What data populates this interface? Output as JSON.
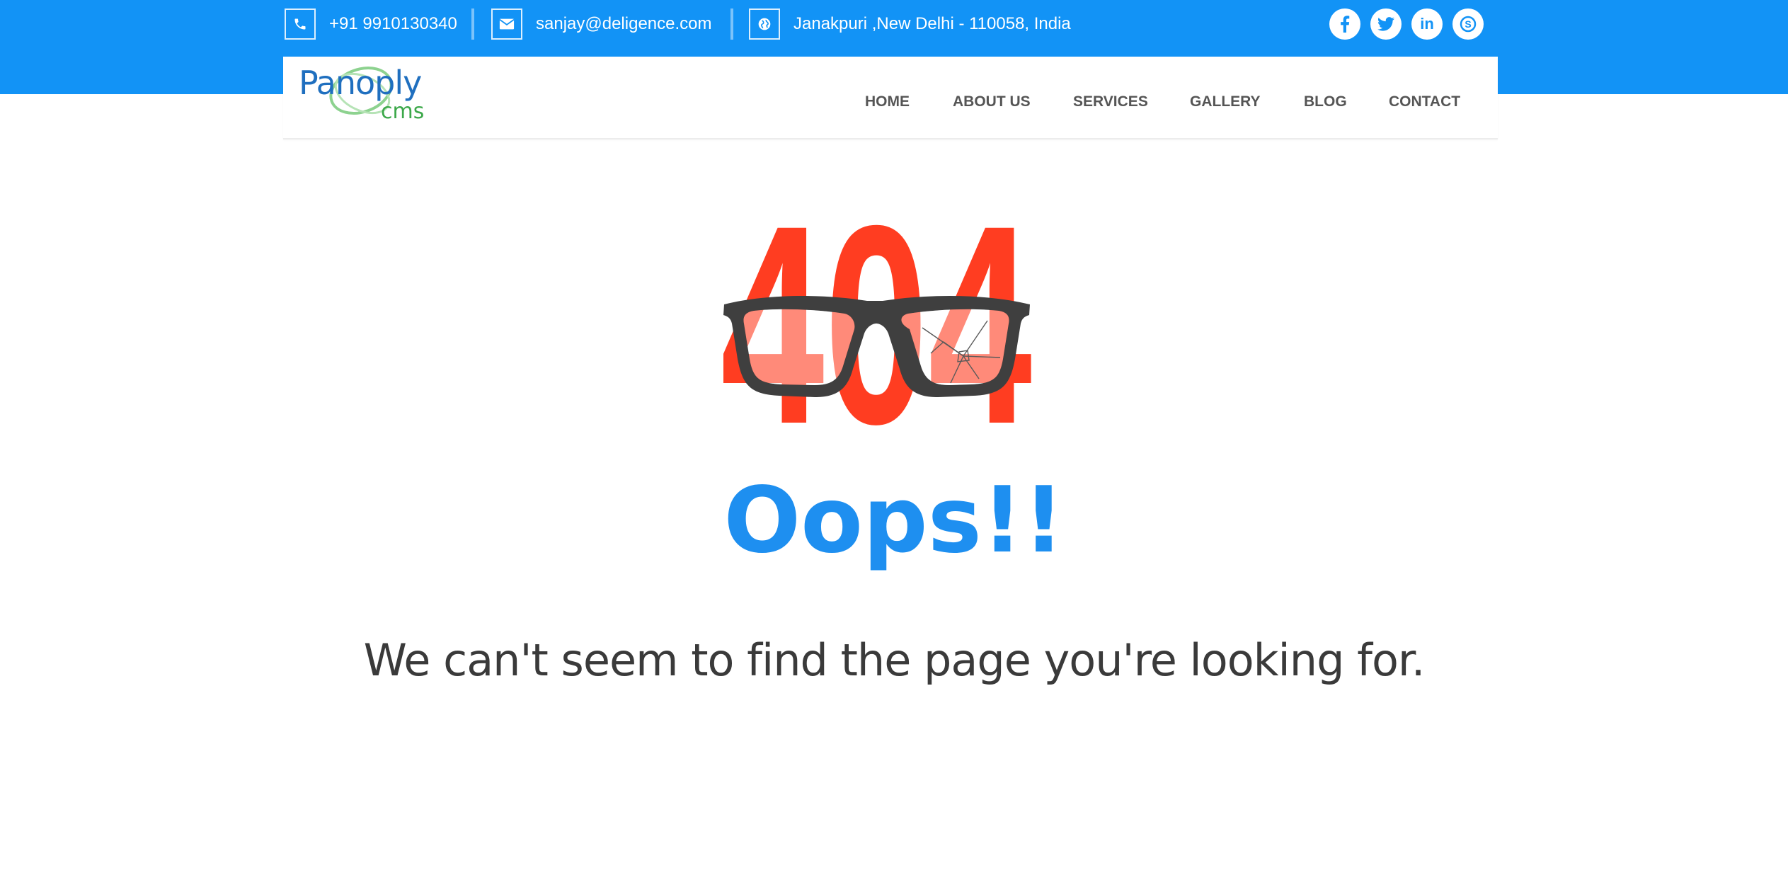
{
  "topbar": {
    "phone": "+91 9910130340",
    "email": "sanjay@deligence.com",
    "address": "Janakpuri ,New Delhi - 110058, India",
    "icons": {
      "phone": "phone-icon",
      "email": "envelope-icon",
      "address": "globe-icon"
    },
    "social": [
      {
        "name": "facebook-icon",
        "glyph": "f"
      },
      {
        "name": "twitter-icon",
        "glyph": ""
      },
      {
        "name": "linkedin-icon",
        "glyph": "in"
      },
      {
        "name": "skype-icon",
        "glyph": "S"
      }
    ]
  },
  "logo": {
    "word": "Panoply",
    "sub": "cms"
  },
  "nav": {
    "home": "HOME",
    "about": "ABOUT US",
    "services": "SERVICES",
    "gallery": "GALLERY",
    "blog": "BLOG",
    "contact": "CONTACT"
  },
  "error": {
    "code": "404",
    "title": "Oops!!",
    "message": "We can't seem to find the page you're looking for."
  },
  "colors": {
    "brand_blue": "#1293f6",
    "error_red": "#ff3d21",
    "oops_blue": "#1e8ff0",
    "text_dark": "#3a3a3a",
    "nav_text": "#555555"
  }
}
